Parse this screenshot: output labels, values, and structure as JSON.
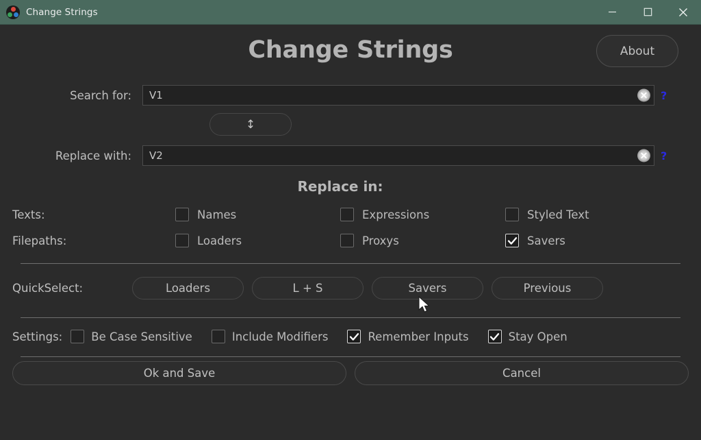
{
  "titlebar": {
    "title": "Change Strings",
    "app_icon": "davinci-resolve-icon",
    "minimize_label": "—",
    "maximize_label": "□",
    "close_label": "✕"
  },
  "header": {
    "title": "Change Strings",
    "about_label": "About"
  },
  "search": {
    "label": "Search for:",
    "value": "V1",
    "placeholder": "",
    "clear_icon": "clear-circle-icon",
    "help_label": "?"
  },
  "swap": {
    "icon_label": "↕"
  },
  "replace": {
    "label": "Replace with:",
    "value": "V2",
    "placeholder": "",
    "clear_icon": "clear-circle-icon",
    "help_label": "?"
  },
  "replace_in": {
    "heading": "Replace in:",
    "rows": [
      {
        "label": "Texts:",
        "options": [
          {
            "label": "Names",
            "checked": false
          },
          {
            "label": "Expressions",
            "checked": false
          },
          {
            "label": "Styled Text",
            "checked": false
          }
        ]
      },
      {
        "label": "Filepaths:",
        "options": [
          {
            "label": "Loaders",
            "checked": false
          },
          {
            "label": "Proxys",
            "checked": false
          },
          {
            "label": "Savers",
            "checked": true
          }
        ]
      }
    ]
  },
  "quickselect": {
    "label": "QuickSelect:",
    "buttons": [
      {
        "label": "Loaders"
      },
      {
        "label": "L + S"
      },
      {
        "label": "Savers"
      },
      {
        "label": "Previous"
      }
    ]
  },
  "settings": {
    "label": "Settings:",
    "options": [
      {
        "label": "Be Case Sensitive",
        "checked": false
      },
      {
        "label": "Include Modifiers",
        "checked": false
      },
      {
        "label": "Remember Inputs",
        "checked": true
      },
      {
        "label": "Stay Open",
        "checked": true
      }
    ]
  },
  "footer": {
    "ok_label": "Ok and Save",
    "cancel_label": "Cancel"
  },
  "colors": {
    "titlebar": "#4a6a5e",
    "background": "#2b2b2b",
    "input_bg": "#222222",
    "text": "#bfbfbf",
    "help_link": "#2a2ae0"
  }
}
